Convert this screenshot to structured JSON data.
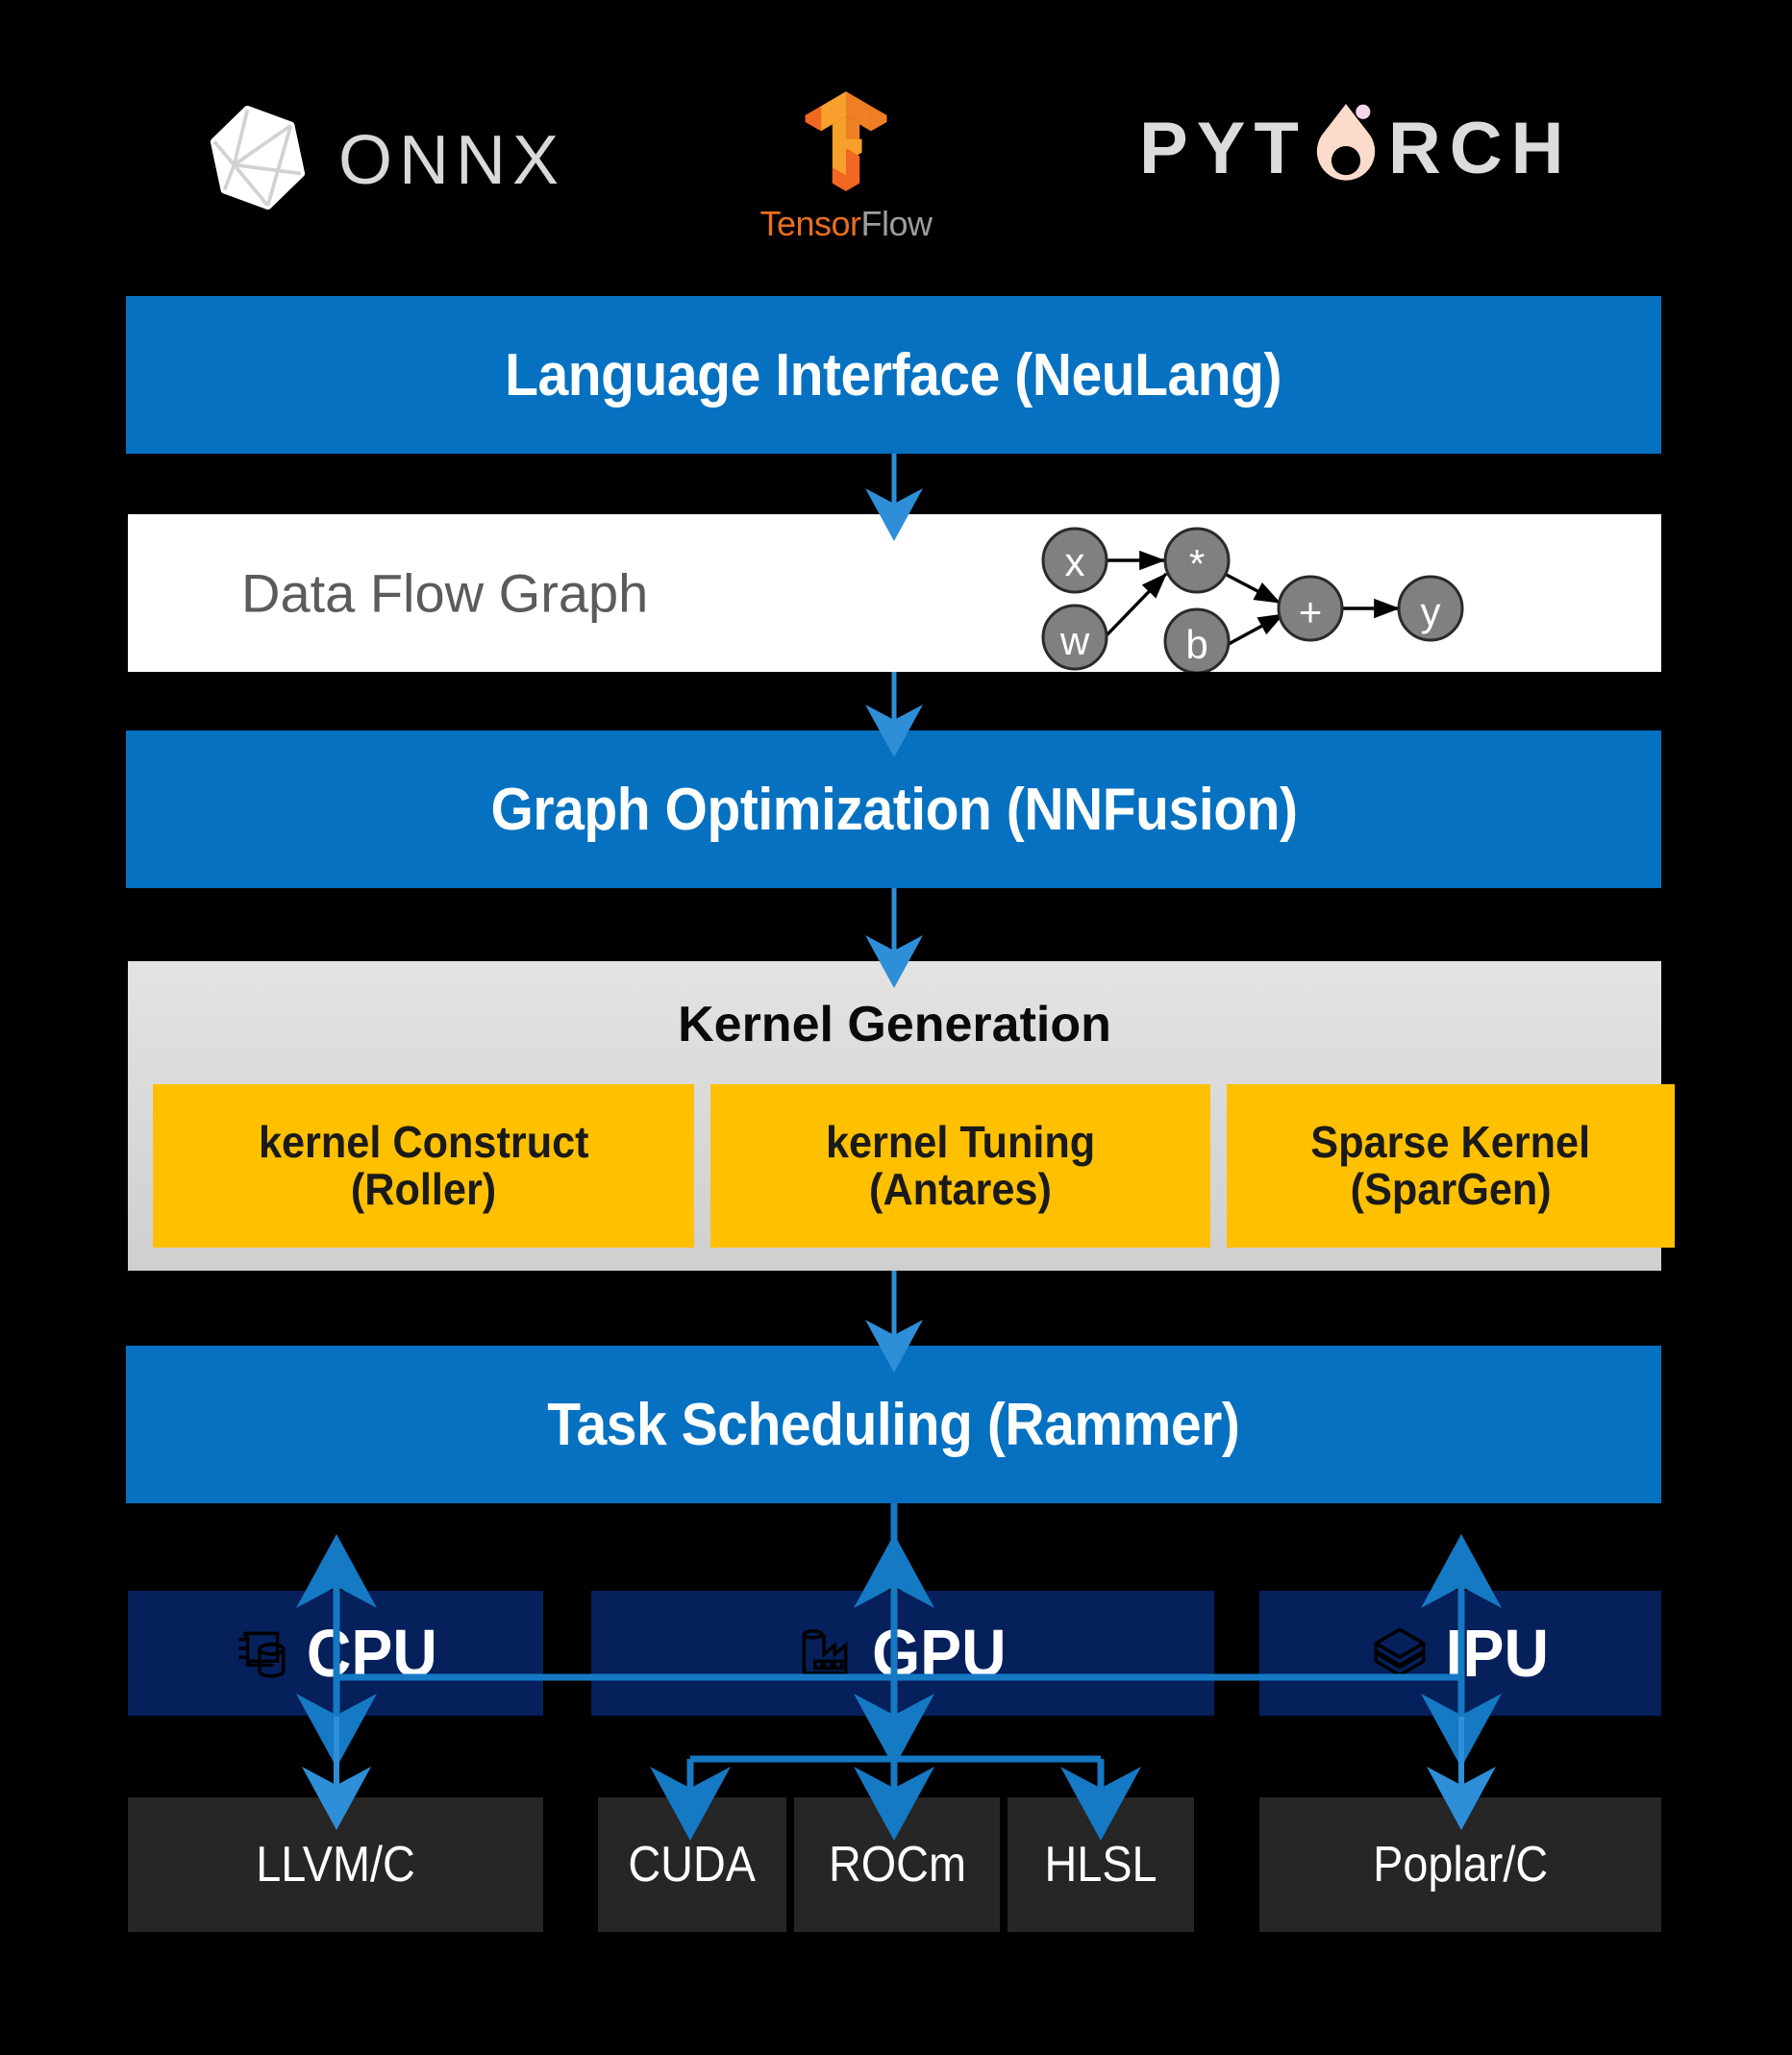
{
  "frameworks": [
    {
      "name": "ONNX",
      "label": "ONNX",
      "icon": "onnx-polyhedron-icon"
    },
    {
      "name": "TensorFlow",
      "label_a": "Tensor",
      "label_b": "Flow",
      "icon": "tensorflow-t-icon"
    },
    {
      "name": "PyTorch",
      "label_pre": "PYT",
      "label_post": "RCH",
      "icon": "pytorch-flame-icon"
    }
  ],
  "stack": {
    "language_interface": "Language Interface (NeuLang)",
    "data_flow_graph": "Data Flow Graph",
    "graph_optimization": "Graph Optimization (NNFusion)",
    "kernel_generation_title": "Kernel Generation",
    "task_scheduling": "Task Scheduling (Rammer)"
  },
  "kernel_boxes": [
    {
      "line1": "kernel Construct",
      "line2": "(Roller)"
    },
    {
      "line1": "kernel Tuning",
      "line2": "(Antares)"
    },
    {
      "line1": "Sparse Kernel",
      "line2": "(SparGen)"
    }
  ],
  "hardware": [
    {
      "label": "CPU",
      "icon": "server-database-icon"
    },
    {
      "label": "GPU",
      "icon": "factory-icon"
    },
    {
      "label": "IPU",
      "icon": "stacked-layers-icon"
    }
  ],
  "backends": [
    {
      "label": "LLVM/C",
      "parent": "CPU"
    },
    {
      "label": "CUDA",
      "parent": "GPU"
    },
    {
      "label": "ROCm",
      "parent": "GPU"
    },
    {
      "label": "HLSL",
      "parent": "GPU"
    },
    {
      "label": "Poplar/C",
      "parent": "IPU"
    }
  ],
  "graph_nodes": [
    {
      "id": "x",
      "label": "x"
    },
    {
      "id": "w",
      "label": "w"
    },
    {
      "id": "mul",
      "label": "*"
    },
    {
      "id": "b",
      "label": "b"
    },
    {
      "id": "add",
      "label": "+"
    },
    {
      "id": "y",
      "label": "y"
    }
  ],
  "graph_edges": [
    {
      "from": "x",
      "to": "mul"
    },
    {
      "from": "w",
      "to": "mul"
    },
    {
      "from": "mul",
      "to": "add"
    },
    {
      "from": "b",
      "to": "add"
    },
    {
      "from": "add",
      "to": "y"
    }
  ],
  "colors": {
    "background": "#000000",
    "stage_blue": "#0571c0",
    "arrow_blue": "#2e8fd8",
    "kernel_yellow": "#ffc000",
    "kernel_panel_gray": "#d9d9d9",
    "hardware_navy": "#06205c",
    "backend_gray": "#262626",
    "graph_node_gray": "#808080",
    "dfg_label_gray": "#5b5b5b",
    "tensorflow_orange": "#e8701e",
    "tensorflow_gray": "#9e9e9e",
    "pytorch_flame": "#fbdccb"
  }
}
